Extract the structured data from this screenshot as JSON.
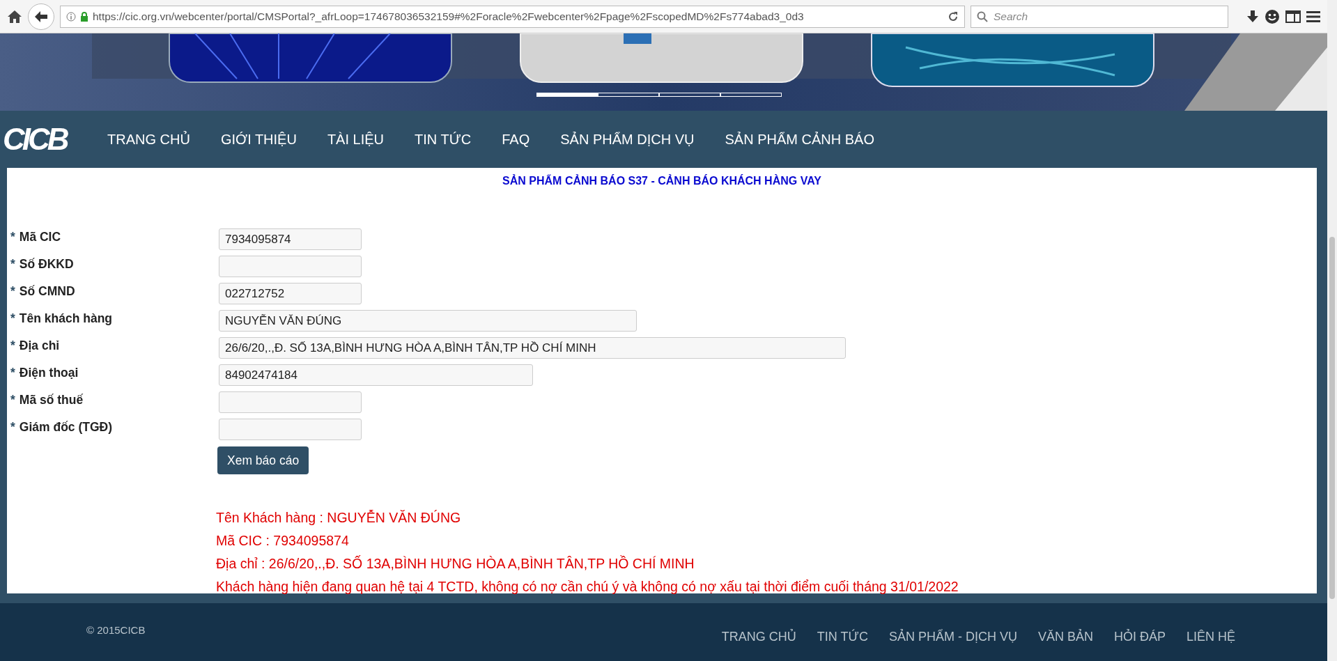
{
  "browser": {
    "url": "https://cic.org.vn/webcenter/portal/CMSPortal?_afrLoop=174678036532159#%2Foracle%2Fwebcenter%2Fpage%2FscopedMD%2Fs774abad3_0d3",
    "search_placeholder": "Search"
  },
  "banner": {
    "slides": [
      {
        "selected": true
      },
      {
        "selected": false
      },
      {
        "selected": false
      },
      {
        "selected": false
      }
    ]
  },
  "nav": {
    "logo": "CICB",
    "items": [
      "TRANG CHỦ",
      "GIỚI THIỆU",
      "TÀI LIỆU",
      "TIN TỨC",
      "FAQ",
      "SẢN PHẨM DỊCH VỤ",
      "SẢN PHẨM CẢNH BÁO"
    ]
  },
  "page_title": "SẢN PHẨM CẢNH BÁO S37 - CẢNH BÁO KHÁCH HÀNG VAY",
  "form": {
    "fields": [
      {
        "label": "Mã CIC",
        "marker": "*",
        "kind": "code",
        "value": "7934095874"
      },
      {
        "label": "Số ĐKKD",
        "marker": "*",
        "kind": "code"
      },
      {
        "label": "Số CMND",
        "marker": "*",
        "kind": "code",
        "value": "022712752"
      },
      {
        "label": "Tên khách hàng",
        "marker": "*",
        "kind": "name",
        "value": "NGUYỄN VĂN ĐÚNG"
      },
      {
        "label": "Địa chỉ",
        "marker": "*",
        "kind": "address",
        "value": "26/6/20,.,Đ. SỐ 13A,BÌNH HƯNG HÒA A,BÌNH TÂN,TP HỒ CHÍ MINH"
      },
      {
        "label": "Điện thoại",
        "marker": "*",
        "kind": "phone",
        "value": "84902474184"
      },
      {
        "label": "Mã số thuế",
        "marker": "*",
        "kind": "code"
      },
      {
        "label": "Giám đốc (TGĐ)",
        "marker": "*",
        "kind": "code"
      }
    ],
    "submit": "Xem báo cáo"
  },
  "result": {
    "lines": [
      "Tên Khách hàng : NGUYỄN VĂN ĐÚNG",
      "Mã CIC : 7934095874",
      "Địa chỉ : 26/6/20,.,Đ. SỐ 13A,BÌNH HƯNG HÒA A,BÌNH TÂN,TP HỒ CHÍ MINH",
      "Khách hàng hiện đang quan hệ tại 4 TCTD, không có nợ cần chú ý và không có nợ xấu tại thời điểm cuối tháng 31/01/2022"
    ]
  },
  "footer": {
    "copyright": "© 2015CICB",
    "links": [
      "TRANG CHỦ",
      "TIN TỨC",
      "SẢN PHẨM - DỊCH VỤ",
      "VĂN BẢN",
      "HỎI ĐÁP",
      "LIÊN HỆ"
    ]
  }
}
